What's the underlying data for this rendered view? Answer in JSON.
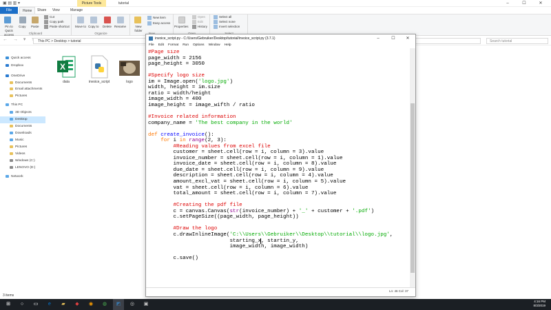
{
  "explorer": {
    "title": "tutorial",
    "context_tab": "Picture Tools",
    "tabs": [
      "File",
      "Home",
      "Share",
      "View",
      "Manage"
    ],
    "ribbon": {
      "pin_label": "Pin to Quick access",
      "copy_label": "Copy",
      "paste_label": "Paste",
      "cut_label": "Cut",
      "copy_path_label": "Copy path",
      "paste_shortcut_label": "Paste shortcut",
      "move_to_label": "Move to",
      "copy_to_label": "Copy to",
      "delete_label": "Delete",
      "rename_label": "Rename",
      "new_folder_label": "New folder",
      "new_item_label": "New item",
      "easy_access_label": "Easy access",
      "properties_label": "Properties",
      "open_label": "Open",
      "edit_label": "Edit",
      "history_label": "History",
      "select_all_label": "Select all",
      "select_none_label": "Select none",
      "invert_selection_label": "Invert selection",
      "group_clipboard": "Clipboard",
      "group_organize": "Organize",
      "group_new": "New",
      "group_open": "Open",
      "group_select": "Select"
    },
    "address": {
      "path": "This PC  >  Desktop  >  tutorial",
      "search_placeholder": "Search tutorial"
    },
    "nav": [
      {
        "label": "Quick access",
        "color": "#3a8fd8"
      },
      {
        "label": "Dropbox",
        "color": "#2a7bd1"
      },
      {
        "label": "OneDrive",
        "color": "#2a7bd1"
      },
      {
        "label": "Documents",
        "color": "#e8c15a"
      },
      {
        "label": "Email attachments",
        "color": "#e8c15a"
      },
      {
        "label": "Pictures",
        "color": "#e8c15a"
      },
      {
        "label": "This PC",
        "color": "#5aa7e8"
      },
      {
        "label": "3D Objects",
        "color": "#5aa7e8"
      },
      {
        "label": "Desktop",
        "color": "#5aa7e8"
      },
      {
        "label": "Documents",
        "color": "#e8c15a"
      },
      {
        "label": "Downloads",
        "color": "#5aa7e8"
      },
      {
        "label": "Music",
        "color": "#5aa7e8"
      },
      {
        "label": "Pictures",
        "color": "#e8c15a"
      },
      {
        "label": "Videos",
        "color": "#e8c15a"
      },
      {
        "label": "Windows (C:)",
        "color": "#8a8a8a"
      },
      {
        "label": "LENOVO (D:)",
        "color": "#8a8a8a"
      },
      {
        "label": "Network",
        "color": "#5aa7e8"
      }
    ],
    "files": [
      {
        "name": "data",
        "icon": "excel-icon"
      },
      {
        "name": "invoice_script",
        "icon": "python-file-icon"
      },
      {
        "name": "logo",
        "icon": "image-thumbnail-icon"
      }
    ],
    "status": "3 items"
  },
  "idle": {
    "title": "invoice_script.py - C:/Users/Gebruiker/Desktop/tutorial/invoice_script.py (3.7.1)",
    "menu": [
      "File",
      "Edit",
      "Format",
      "Run",
      "Options",
      "Window",
      "Help"
    ],
    "status": "Ln: 46   Col: 37",
    "code": [
      {
        "t": "cm",
        "s": "#Page size"
      },
      {
        "t": "",
        "s": "page_width = 2156"
      },
      {
        "t": "",
        "s": "page_height = 3050"
      },
      {
        "t": "",
        "s": ""
      },
      {
        "t": "cm",
        "s": "#Specify logo size"
      },
      {
        "t": "mix",
        "parts": [
          [
            "",
            "im = Image.open("
          ],
          [
            "st",
            "'logo.jpg'"
          ],
          [
            "",
            ")"
          ]
        ]
      },
      {
        "t": "",
        "s": "width, height = im.size"
      },
      {
        "t": "",
        "s": "ratio = width/height"
      },
      {
        "t": "",
        "s": "image_width = 400"
      },
      {
        "t": "",
        "s": "image_height = image_wifth / ratio"
      },
      {
        "t": "",
        "s": ""
      },
      {
        "t": "cm",
        "s": "#Invoice related information"
      },
      {
        "t": "mix",
        "parts": [
          [
            "",
            "company_name = "
          ],
          [
            "st",
            "'The best company in the world'"
          ]
        ]
      },
      {
        "t": "",
        "s": ""
      },
      {
        "t": "mix",
        "parts": [
          [
            "kw",
            "def"
          ],
          [
            "",
            " "
          ],
          [
            "fn",
            "create_invoice"
          ],
          [
            "",
            "():"
          ]
        ]
      },
      {
        "t": "mix",
        "parts": [
          [
            "",
            "    "
          ],
          [
            "kw",
            "for"
          ],
          [
            "",
            " i "
          ],
          [
            "kw",
            "in"
          ],
          [
            "",
            " "
          ],
          [
            "bi",
            "range"
          ],
          [
            "",
            "(2, 3):"
          ]
        ]
      },
      {
        "t": "cm",
        "s": "        #Reading values from excel file"
      },
      {
        "t": "",
        "s": "        customer = sheet.cell(row = i, column = 3).value"
      },
      {
        "t": "",
        "s": "        invoice_number = sheet.cell(row = i, column = 1).value"
      },
      {
        "t": "",
        "s": "        invoice_date = sheet.cell(row = i, column = 8).value"
      },
      {
        "t": "",
        "s": "        due_date = sheet.cell(row = i, column = 9).value"
      },
      {
        "t": "",
        "s": "        description = sheet.cell(row = i, column = 4).value"
      },
      {
        "t": "",
        "s": "        amount_excl_vat = sheet.cell(row = i, column = 5).value"
      },
      {
        "t": "",
        "s": "        vat = sheet.cell(row = i, column = 6).value"
      },
      {
        "t": "",
        "s": "        total_amount = sheet.cell(row = i, column = 7).value"
      },
      {
        "t": "",
        "s": ""
      },
      {
        "t": "cm",
        "s": "        #Creating the pdf file"
      },
      {
        "t": "mix",
        "parts": [
          [
            "",
            "        c = canvas.Canvas("
          ],
          [
            "bi",
            "str"
          ],
          [
            "",
            "(invoice_number) + "
          ],
          [
            "st",
            "'_'"
          ],
          [
            "",
            " + customer + "
          ],
          [
            "st",
            "'.pdf'"
          ],
          [
            "",
            ")"
          ]
        ]
      },
      {
        "t": "",
        "s": "        c.setPageSize((page_width, page_height))"
      },
      {
        "t": "",
        "s": ""
      },
      {
        "t": "cm",
        "s": "        #Draw the logo"
      },
      {
        "t": "mix",
        "parts": [
          [
            "",
            "        c.drawInlineImage("
          ],
          [
            "st",
            "'C:\\\\Users\\\\Gebruiker\\\\Desktop\\\\tutorial\\\\logo.jpg'"
          ],
          [
            "",
            ","
          ]
        ]
      },
      {
        "t": "cur",
        "parts": [
          [
            "",
            "                          starting_x"
          ],
          [
            "",
            ", startin_y,"
          ]
        ]
      },
      {
        "t": "",
        "s": "                          image_width, image_width)"
      },
      {
        "t": "",
        "s": ""
      },
      {
        "t": "",
        "s": "        c.save()"
      }
    ]
  },
  "taskbar": {
    "time": "4:16 PM",
    "date": "8/3/2019"
  }
}
